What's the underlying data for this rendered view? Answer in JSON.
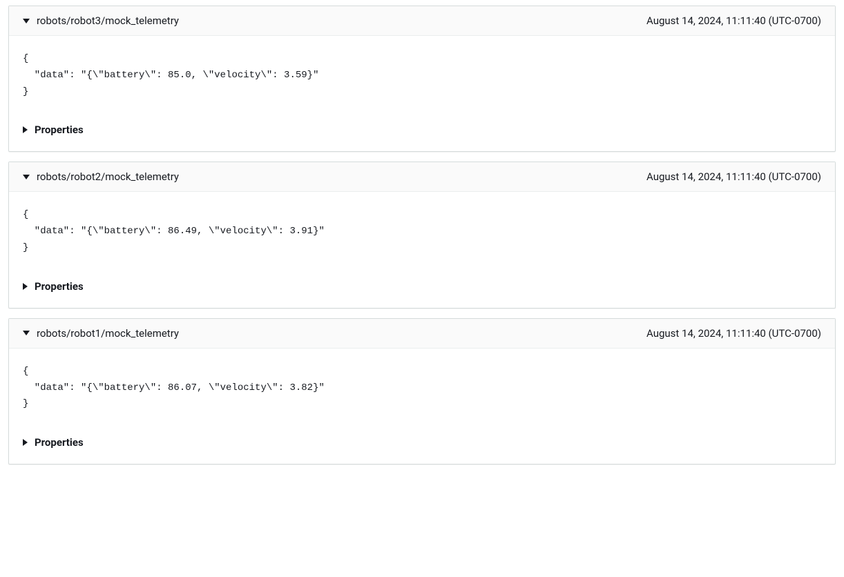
{
  "properties_label": "Properties",
  "messages": [
    {
      "topic": "robots/robot3/mock_telemetry",
      "timestamp": "August 14, 2024, 11:11:40 (UTC-0700)",
      "payload": "{\n  \"data\": \"{\\\"battery\\\": 85.0, \\\"velocity\\\": 3.59}\"\n}"
    },
    {
      "topic": "robots/robot2/mock_telemetry",
      "timestamp": "August 14, 2024, 11:11:40 (UTC-0700)",
      "payload": "{\n  \"data\": \"{\\\"battery\\\": 86.49, \\\"velocity\\\": 3.91}\"\n}"
    },
    {
      "topic": "robots/robot1/mock_telemetry",
      "timestamp": "August 14, 2024, 11:11:40 (UTC-0700)",
      "payload": "{\n  \"data\": \"{\\\"battery\\\": 86.07, \\\"velocity\\\": 3.82}\"\n}"
    }
  ]
}
